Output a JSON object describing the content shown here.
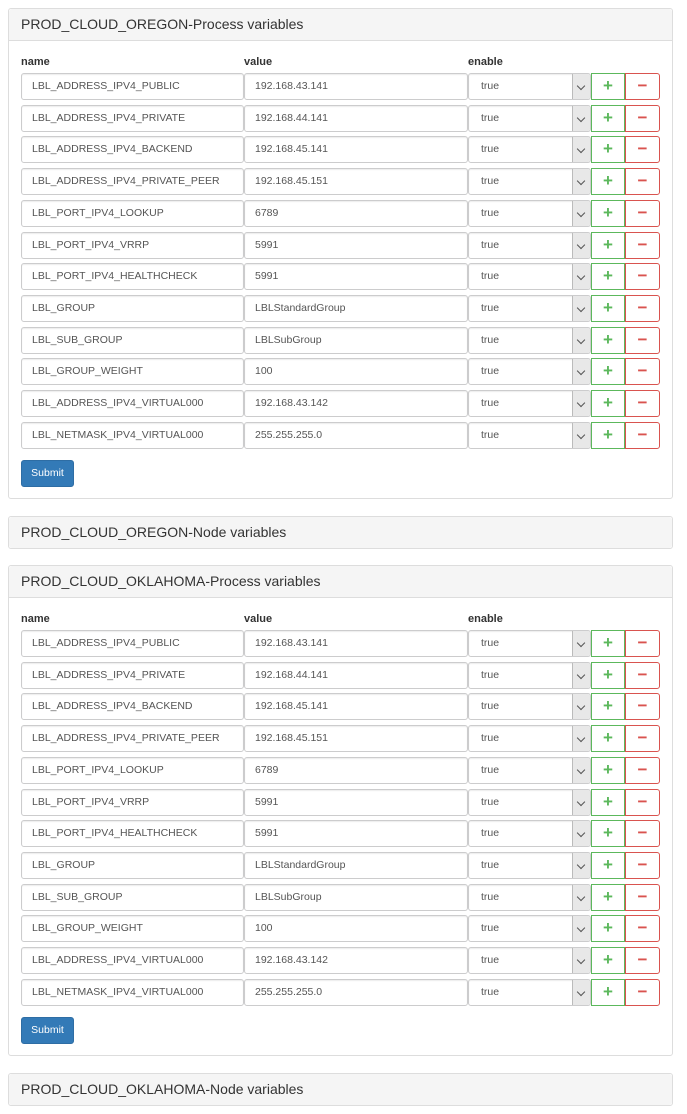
{
  "panels": [
    {
      "title": "PROD_CLOUD_OREGON-Process variables",
      "columns": {
        "name": "name",
        "value": "value",
        "enable": "enable"
      },
      "rows": [
        {
          "name": "LBL_ADDRESS_IPV4_PUBLIC",
          "value": "192.168.43.141",
          "enable": "true"
        },
        {
          "name": "LBL_ADDRESS_IPV4_PRIVATE",
          "value": "192.168.44.141",
          "enable": "true"
        },
        {
          "name": "LBL_ADDRESS_IPV4_BACKEND",
          "value": "192.168.45.141",
          "enable": "true"
        },
        {
          "name": "LBL_ADDRESS_IPV4_PRIVATE_PEER",
          "value": "192.168.45.151",
          "enable": "true"
        },
        {
          "name": "LBL_PORT_IPV4_LOOKUP",
          "value": "6789",
          "enable": "true"
        },
        {
          "name": "LBL_PORT_IPV4_VRRP",
          "value": "5991",
          "enable": "true"
        },
        {
          "name": "LBL_PORT_IPV4_HEALTHCHECK",
          "value": "5991",
          "enable": "true"
        },
        {
          "name": "LBL_GROUP",
          "value": "LBLStandardGroup",
          "enable": "true"
        },
        {
          "name": "LBL_SUB_GROUP",
          "value": "LBLSubGroup",
          "enable": "true"
        },
        {
          "name": "LBL_GROUP_WEIGHT",
          "value": "100",
          "enable": "true"
        },
        {
          "name": "LBL_ADDRESS_IPV4_VIRTUAL000",
          "value": "192.168.43.142",
          "enable": "true"
        },
        {
          "name": "LBL_NETMASK_IPV4_VIRTUAL000",
          "value": "255.255.255.0",
          "enable": "true"
        }
      ],
      "submit_label": "Submit"
    },
    {
      "title": "PROD_CLOUD_OREGON-Node variables"
    },
    {
      "title": "PROD_CLOUD_OKLAHOMA-Process variables",
      "columns": {
        "name": "name",
        "value": "value",
        "enable": "enable"
      },
      "rows": [
        {
          "name": "LBL_ADDRESS_IPV4_PUBLIC",
          "value": "192.168.43.141",
          "enable": "true"
        },
        {
          "name": "LBL_ADDRESS_IPV4_PRIVATE",
          "value": "192.168.44.141",
          "enable": "true"
        },
        {
          "name": "LBL_ADDRESS_IPV4_BACKEND",
          "value": "192.168.45.141",
          "enable": "true"
        },
        {
          "name": "LBL_ADDRESS_IPV4_PRIVATE_PEER",
          "value": "192.168.45.151",
          "enable": "true"
        },
        {
          "name": "LBL_PORT_IPV4_LOOKUP",
          "value": "6789",
          "enable": "true"
        },
        {
          "name": "LBL_PORT_IPV4_VRRP",
          "value": "5991",
          "enable": "true"
        },
        {
          "name": "LBL_PORT_IPV4_HEALTHCHECK",
          "value": "5991",
          "enable": "true"
        },
        {
          "name": "LBL_GROUP",
          "value": "LBLStandardGroup",
          "enable": "true"
        },
        {
          "name": "LBL_SUB_GROUP",
          "value": "LBLSubGroup",
          "enable": "true"
        },
        {
          "name": "LBL_GROUP_WEIGHT",
          "value": "100",
          "enable": "true"
        },
        {
          "name": "LBL_ADDRESS_IPV4_VIRTUAL000",
          "value": "192.168.43.142",
          "enable": "true"
        },
        {
          "name": "LBL_NETMASK_IPV4_VIRTUAL000",
          "value": "255.255.255.0",
          "enable": "true"
        }
      ],
      "submit_label": "Submit"
    },
    {
      "title": "PROD_CLOUD_OKLAHOMA-Node variables"
    }
  ],
  "icons": {
    "add": "plus-icon",
    "remove": "minus-icon",
    "dropdown": "chevron-down-icon"
  },
  "colors": {
    "add": "#5cb85c",
    "remove": "#d9534f",
    "submit": "#337ab7",
    "heading_bg": "#f5f5f5"
  }
}
